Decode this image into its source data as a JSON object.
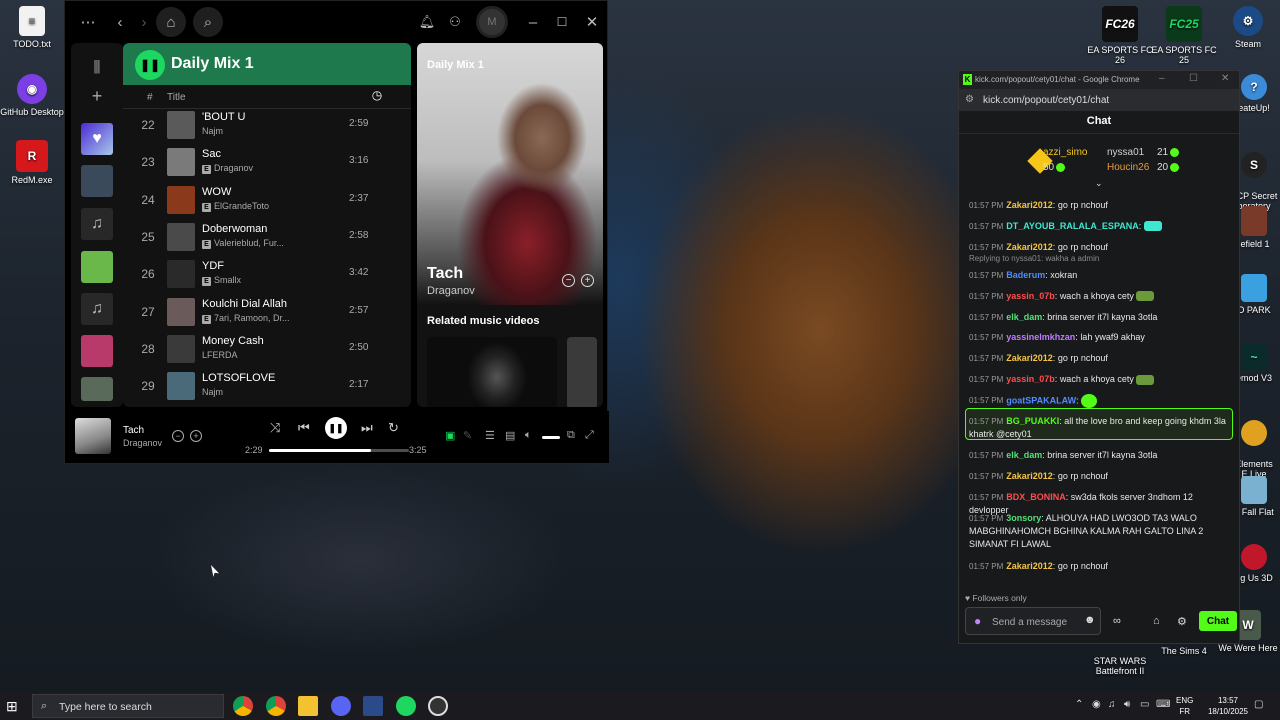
{
  "desktop": {
    "left_icons": [
      {
        "label": "TODO.txt",
        "icon": "text-file-icon"
      },
      {
        "label": "GitHub Desktop",
        "icon": "github-icon"
      },
      {
        "label": "RedM.exe",
        "icon": "redm-icon"
      }
    ],
    "top_right_icons": [
      {
        "label": "EA SPORTS FC 26",
        "badge": "FC26"
      },
      {
        "label": "EA SPORTS FC 25",
        "badge": "FC25"
      },
      {
        "label": "Steam",
        "badge": "steam"
      }
    ],
    "right_partial_labels": [
      "eateUp!",
      "SCP Secret\nboratory",
      "lefield 1",
      "O PARK",
      "emod V3",
      "Elements\nE.Live",
      "n Fall Flat",
      "ng Us 3D"
    ],
    "bottom_right_icons": [
      {
        "label": "STAR WARS\nBattlefront II"
      },
      {
        "label": "The Sims 4"
      },
      {
        "label": "We Were Here"
      }
    ]
  },
  "spotify": {
    "avatar_initial": "M",
    "playlist_title": "Daily Mix 1",
    "col_hash": "#",
    "col_title": "Title",
    "tracks": [
      {
        "num": "22",
        "name": "'BOUT U",
        "artist": "Najm",
        "explicit": false,
        "duration": "2:59",
        "color": "#5a5a5a"
      },
      {
        "num": "23",
        "name": "Sac",
        "artist": "Draganov",
        "explicit": true,
        "duration": "3:16",
        "color": "#7a7a7a"
      },
      {
        "num": "24",
        "name": "WOW",
        "artist": "ElGrandeToto",
        "explicit": true,
        "duration": "2:37",
        "color": "#8a3a1a"
      },
      {
        "num": "25",
        "name": "Doberwoman",
        "artist": "Valerieblud, Fur...",
        "explicit": true,
        "duration": "2:58",
        "color": "#4a4a4a"
      },
      {
        "num": "26",
        "name": "YDF",
        "artist": "Smallx",
        "explicit": true,
        "duration": "3:42",
        "color": "#2a2a2a"
      },
      {
        "num": "27",
        "name": "Koulchi Dial Allah",
        "artist": "7ari, Ramoon, Dr...",
        "explicit": true,
        "duration": "2:57",
        "color": "#6a5a5a"
      },
      {
        "num": "28",
        "name": "Money Cash",
        "artist": "LFERDA",
        "explicit": false,
        "duration": "2:50",
        "color": "#3a3a3a"
      },
      {
        "num": "29",
        "name": "LOTSOFLOVE",
        "artist": "Najm",
        "explicit": false,
        "duration": "2:17",
        "color": "#4a6a7a"
      }
    ],
    "now_playing_panel": {
      "label": "Daily Mix 1",
      "song": "Tach",
      "artist": "Draganov",
      "related_label": "Related music videos"
    },
    "player": {
      "song": "Tach",
      "artist": "Draganov",
      "elapsed": "2:29",
      "total": "3:25",
      "progress_fraction": 0.727
    }
  },
  "kick": {
    "window_title": "kick.com/popout/cety01/chat - Google Chrome",
    "url": "kick.com/popout/cety01/chat",
    "chat_heading": "Chat",
    "leaderboard": [
      {
        "name": "azzi_simo",
        "count": "50",
        "color": "#f5c518"
      },
      {
        "name": "nyssa01",
        "count": "21",
        "color": "#cfcfcf"
      },
      {
        "name": "Houcin26",
        "count": "20",
        "color": "#e89a3c"
      }
    ],
    "reply_text": "Replying to nyssa01: wakha a admin",
    "messages": [
      {
        "time": "01:57 PM",
        "user": "Zakari2012",
        "color": "#f5c542",
        "text": "go rp nchouf"
      },
      {
        "time": "01:57 PM",
        "user": "DT_AYOUB_RALALA_ESPANA",
        "color": "#3ee8d0",
        "text": ""
      },
      {
        "time": "01:57 PM",
        "user": "Zakari2012",
        "color": "#f5c542",
        "text": "go rp nchouf"
      },
      {
        "time": "01:57 PM",
        "user": "Baderum",
        "color": "#4f8cff",
        "text": "xokran"
      },
      {
        "time": "01:57 PM",
        "user": "yassin_07b",
        "color": "#ff4d4d",
        "text": "wach a khoya cety"
      },
      {
        "time": "01:57 PM",
        "user": "elk_dam",
        "color": "#53e07a",
        "text": "brina server it7l kayna 3otla"
      },
      {
        "time": "01:57 PM",
        "user": "yassinelmkhzan",
        "color": "#c07cff",
        "text": "lah ywaf9 akhay"
      },
      {
        "time": "01:57 PM",
        "user": "Zakari2012",
        "color": "#f5c542",
        "text": "go rp nchouf"
      },
      {
        "time": "01:57 PM",
        "user": "yassin_07b",
        "color": "#ff4d4d",
        "text": "wach a khoya cety"
      },
      {
        "time": "01:57 PM",
        "user": "goatSPAKALAW",
        "color": "#4f8cff",
        "text": ""
      },
      {
        "time": "01:57 PM",
        "user": "BG_PUAKKI",
        "color": "#53fc18",
        "text": "all the love bro and keep going khdm 3la khatrk @cety01"
      },
      {
        "time": "01:57 PM",
        "user": "elk_dam",
        "color": "#53e07a",
        "text": "brina server it7l kayna 3otla"
      },
      {
        "time": "01:57 PM",
        "user": "Zakari2012",
        "color": "#f5c542",
        "text": "go rp nchouf"
      },
      {
        "time": "01:57 PM",
        "user": "BDX_BONINA",
        "color": "#ff4d4d",
        "text": "sw3da fkols server 3ndhom 12 devlopper"
      },
      {
        "time": "01:57 PM",
        "user": "3onsory",
        "color": "#53e07a",
        "text": "ALHOUYA HAD LWO3OD TA3 WALO MABGHINAHOMCH BGHINA KALMA RAH GALTO LINA 2 SIMANAT FI LAWAL"
      },
      {
        "time": "01:57 PM",
        "user": "Zakari2012",
        "color": "#f5c542",
        "text": "go rp nchouf"
      }
    ],
    "followers_only": "Followers only",
    "input_placeholder": "Send a message",
    "chat_button": "Chat"
  },
  "taskbar": {
    "search_placeholder": "Type here to search",
    "lang_line1": "ENG",
    "lang_line2": "FR",
    "time": "13:57",
    "date": "18/10/2025"
  }
}
